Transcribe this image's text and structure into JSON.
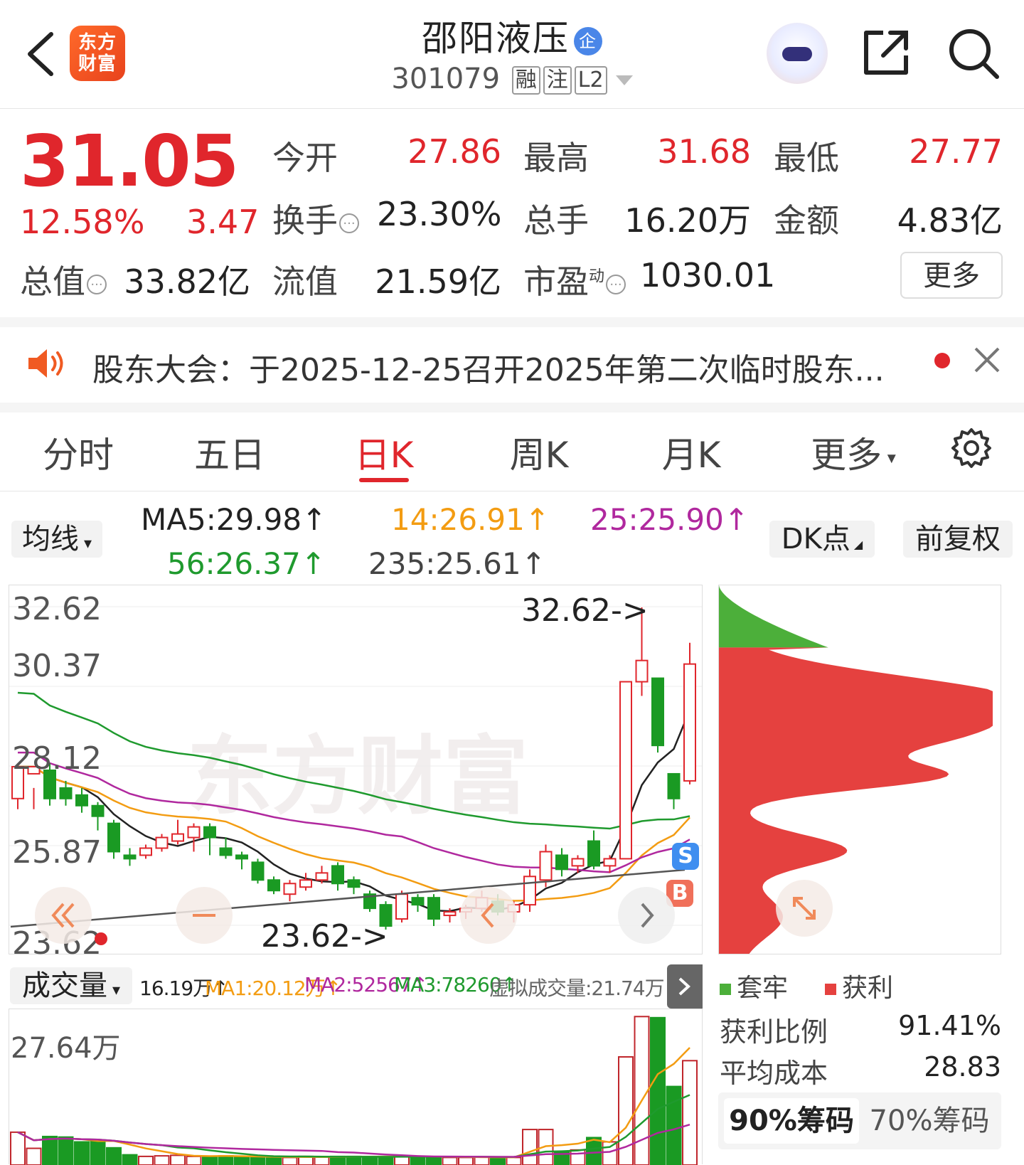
{
  "header": {
    "brand_logo_text": "东方财富",
    "stock_name": "邵阳液压",
    "badge": "企",
    "code": "301079",
    "tags": [
      "融",
      "注",
      "L2"
    ]
  },
  "quote": {
    "price": "31.05",
    "change_pct": "12.58%",
    "change": "3.47",
    "fields": [
      {
        "label": "今开",
        "value": "27.86",
        "red": true
      },
      {
        "label": "最高",
        "value": "31.68",
        "red": true
      },
      {
        "label": "最低",
        "value": "27.77",
        "red": true
      },
      {
        "label": "换手",
        "value": "23.30%",
        "red": false,
        "info": true
      },
      {
        "label": "总手",
        "value": "16.20万",
        "red": false
      },
      {
        "label": "金额",
        "value": "4.83亿",
        "red": false
      },
      {
        "label": "总值",
        "value": "33.82亿",
        "red": false,
        "info": true
      },
      {
        "label": "流值",
        "value": "21.59亿",
        "red": false
      },
      {
        "label": "市盈",
        "sup": "动",
        "value": "1030.01",
        "red": false,
        "info": true
      }
    ],
    "more_label": "更多"
  },
  "notice": {
    "text": "股东大会：于2025-12-25召开2025年第二次临时股东..."
  },
  "tabs": [
    {
      "label": "分时"
    },
    {
      "label": "五日"
    },
    {
      "label": "日K",
      "active": true
    },
    {
      "label": "周K"
    },
    {
      "label": "月K"
    },
    {
      "label": "更多"
    }
  ],
  "ma_bar": {
    "mode": "均线",
    "ma5": "MA5:29.98",
    "ma14": "14:26.91",
    "ma25": "25:25.90",
    "ma56": "56:26.37",
    "ma235": "235:25.61",
    "dk": "DK点",
    "adjust": "前复权"
  },
  "kline": {
    "y_ticks": [
      "32.62",
      "30.37",
      "28.12",
      "25.87",
      "23.62"
    ],
    "watermark": "东方财富",
    "high_label": "32.62->",
    "low_label": "23.62->",
    "sell_marker": "S",
    "buy_marker": "B"
  },
  "chart_data": {
    "type": "candlestick",
    "ylim": [
      23.62,
      32.62
    ],
    "y_ticks": [
      32.62,
      30.37,
      28.12,
      25.87,
      23.62
    ],
    "candles": [
      [
        27.2,
        28.1,
        27.5,
        26.9
      ],
      [
        27.9,
        28.1,
        27.5,
        26.9
      ],
      [
        28.0,
        27.2,
        28.2,
        27.0
      ],
      [
        27.5,
        27.2,
        27.7,
        27.0
      ],
      [
        27.3,
        27.0,
        27.5,
        26.8
      ],
      [
        27.0,
        26.7,
        27.1,
        26.3
      ],
      [
        26.5,
        25.7,
        26.6,
        25.5
      ],
      [
        25.6,
        25.5,
        25.8,
        25.3
      ],
      [
        25.6,
        25.8,
        25.9,
        25.5
      ],
      [
        25.8,
        26.1,
        26.2,
        25.7
      ],
      [
        26.0,
        26.2,
        26.6,
        25.9
      ],
      [
        26.1,
        26.4,
        26.5,
        25.7
      ],
      [
        26.4,
        26.1,
        26.5,
        25.6
      ],
      [
        25.8,
        25.6,
        26.1,
        25.5
      ],
      [
        25.6,
        25.5,
        25.7,
        25.2
      ],
      [
        25.4,
        24.9,
        25.5,
        24.8
      ],
      [
        24.9,
        24.6,
        25.0,
        24.5
      ],
      [
        24.5,
        24.8,
        24.9,
        24.3
      ],
      [
        24.7,
        24.9,
        25.1,
        24.6
      ],
      [
        24.9,
        25.1,
        25.3,
        24.8
      ],
      [
        25.3,
        24.8,
        25.4,
        24.6
      ],
      [
        24.9,
        24.7,
        25.0,
        24.5
      ],
      [
        24.5,
        24.1,
        24.6,
        24.0
      ],
      [
        24.2,
        23.6,
        24.3,
        23.5
      ],
      [
        23.8,
        24.5,
        24.6,
        23.7
      ],
      [
        24.4,
        24.2,
        24.5,
        24.0
      ],
      [
        24.4,
        23.8,
        24.5,
        23.6
      ],
      [
        23.9,
        24.0,
        24.1,
        23.7
      ],
      [
        24.0,
        24.1,
        24.2,
        23.8
      ],
      [
        24.1,
        24.4,
        24.6,
        24.0
      ],
      [
        24.3,
        24.0,
        24.5,
        23.9
      ],
      [
        24.0,
        24.2,
        24.3,
        23.7
      ],
      [
        24.2,
        25.0,
        25.2,
        24.0
      ],
      [
        24.9,
        25.7,
        25.9,
        24.7
      ],
      [
        25.6,
        25.2,
        25.8,
        25.0
      ],
      [
        25.3,
        25.5,
        25.6,
        25.1
      ],
      [
        26.0,
        25.3,
        26.3,
        25.2
      ],
      [
        25.3,
        25.5,
        25.6,
        25.1
      ],
      [
        25.5,
        30.5,
        30.5,
        25.5
      ],
      [
        30.5,
        31.1,
        32.6,
        30.1
      ],
      [
        30.6,
        28.7,
        30.6,
        28.5
      ],
      [
        27.9,
        27.2,
        27.9,
        26.9
      ],
      [
        27.7,
        31.0,
        31.6,
        27.6
      ]
    ]
  },
  "volume": {
    "mode": "成交量",
    "current": "16.19万",
    "ma1": "MA1:20.12万",
    "ma2": "MA2:52567",
    "ma3": "MA3:78260",
    "virtual": "虚拟成交量:21.74万",
    "y_tick": "27.64万"
  },
  "volume_data": {
    "values": [
      6.1,
      3.1,
      5.3,
      5.2,
      4.3,
      4.4,
      3.2,
      1.9,
      1.6,
      1.7,
      1.8,
      1.6,
      1.6,
      1.7,
      1.5,
      1.5,
      1.4,
      1.4,
      1.6,
      1.5,
      1.6,
      1.6,
      1.5,
      1.6,
      1.7,
      1.5,
      1.5,
      1.4,
      1.4,
      1.5,
      1.4,
      1.4,
      6.6,
      6.6,
      2.4,
      2.8,
      5.1,
      4.3,
      20.1,
      27.6,
      27.4,
      14.6,
      19.4
    ],
    "ymax": 27.64
  },
  "chips": {
    "legend": [
      "套牢",
      "获利"
    ],
    "stats": [
      {
        "label": "获利比例",
        "value": "91.41%"
      },
      {
        "label": "平均成本",
        "value": "28.83"
      }
    ],
    "tabs": [
      "90%筹码",
      "70%筹码"
    ],
    "colors": {
      "trapped": "#4caf3a",
      "profit": "#e5413f"
    }
  }
}
